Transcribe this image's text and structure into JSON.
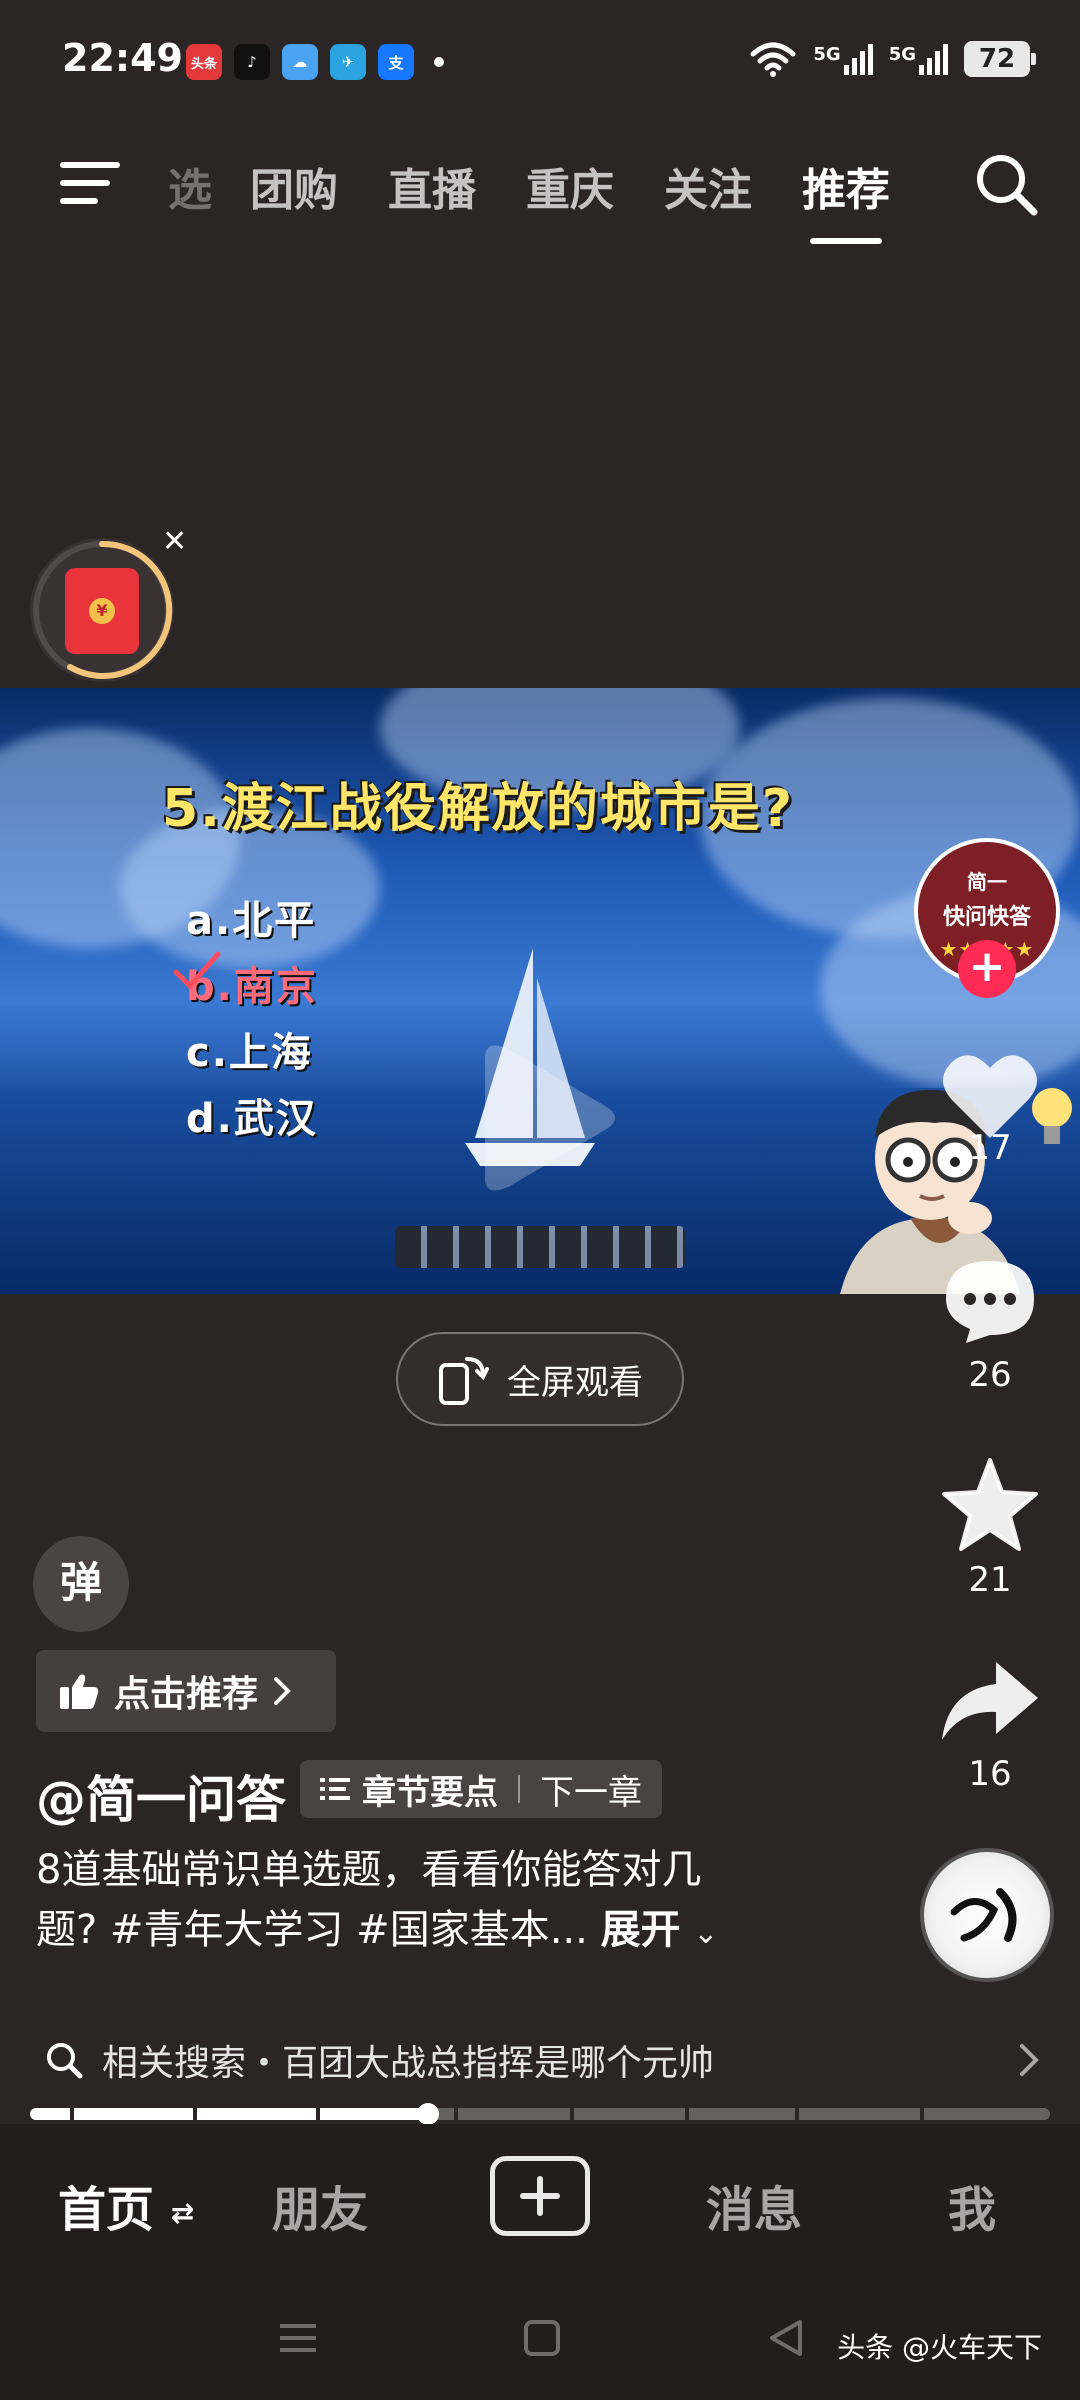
{
  "status_bar": {
    "time": "22:49",
    "apps": [
      {
        "icon": "toutiao-icon",
        "label": "头条",
        "color": "#e23a3a"
      },
      {
        "icon": "douyin-icon",
        "label": "♪",
        "color": "#111111"
      },
      {
        "icon": "weather-icon",
        "label": "☁",
        "color": "#4aa3f0"
      },
      {
        "icon": "telegram-icon",
        "label": "✈",
        "color": "#2aa3e0"
      },
      {
        "icon": "alipay-icon",
        "label": "支",
        "color": "#1677ff"
      }
    ],
    "signal_1": "5G",
    "signal_2": "5G",
    "battery": "72"
  },
  "top_nav": {
    "tabs": [
      "选",
      "团购",
      "直播",
      "重庆",
      "关注",
      "推荐"
    ],
    "active_tab": "推荐"
  },
  "video": {
    "question": "5.渡江战役解放的城市是?",
    "options": [
      "a.北平",
      "b.南京",
      "c.上海",
      "d.武汉"
    ],
    "correct_option_index": 1,
    "channel_badge": {
      "line1": "简一",
      "line2": "快问快答",
      "stars": "★★★★★"
    }
  },
  "actions": {
    "like_count": "17",
    "comment_count": "26",
    "favorite_count": "21",
    "share_count": "16"
  },
  "fullscreen_label": "全屏观看",
  "danmu_label": "弹",
  "recommend_label": "点击推荐",
  "author": "@简一问答",
  "chapter": {
    "points_label": "章节要点",
    "next_label": "下一章"
  },
  "description": {
    "line1": "8道基础常识单选题，看看你能答对几",
    "line2": "题? #青年大学习 #国家基本...",
    "more": "展开"
  },
  "related_search": "相关搜索・百团大战总指挥是哪个元帅",
  "progress": {
    "played_fraction": 0.39
  },
  "bottom_nav": {
    "home": "首页",
    "friends": "朋友",
    "messages": "消息",
    "me": "我"
  },
  "watermark": "头条 @火车天下"
}
